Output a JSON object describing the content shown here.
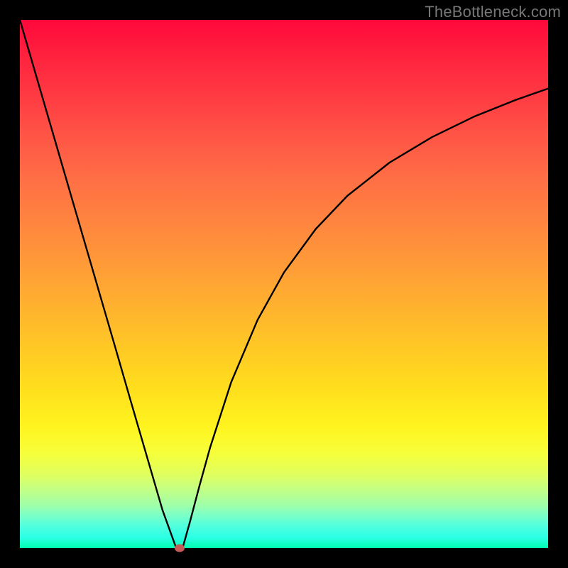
{
  "watermark": "TheBottleneck.com",
  "chart_data": {
    "type": "line",
    "title": "",
    "xlabel": "",
    "ylabel": "",
    "xlim": [
      0,
      1
    ],
    "ylim": [
      0,
      1
    ],
    "series": [
      {
        "name": "curve",
        "x": [
          0.0,
          0.03,
          0.06,
          0.09,
          0.12,
          0.15,
          0.18,
          0.21,
          0.24,
          0.27,
          0.296,
          0.308,
          0.322,
          0.34,
          0.36,
          0.4,
          0.45,
          0.5,
          0.56,
          0.62,
          0.7,
          0.78,
          0.86,
          0.94,
          1.0
        ],
        "y": [
          1.0,
          0.897,
          0.794,
          0.691,
          0.588,
          0.485,
          0.382,
          0.278,
          0.175,
          0.072,
          0.0,
          0.0,
          0.05,
          0.118,
          0.19,
          0.314,
          0.432,
          0.522,
          0.604,
          0.667,
          0.73,
          0.778,
          0.817,
          0.849,
          0.87
        ]
      }
    ],
    "plateau": {
      "x_start": 0.296,
      "x_end": 0.308,
      "y": 0.0
    },
    "marker": {
      "x": 0.302,
      "y": 0.0,
      "color": "#c65a56"
    },
    "background_gradient": {
      "top": "#ff083a",
      "mid": "#ffd020",
      "bottom": "#00ffb0"
    }
  }
}
